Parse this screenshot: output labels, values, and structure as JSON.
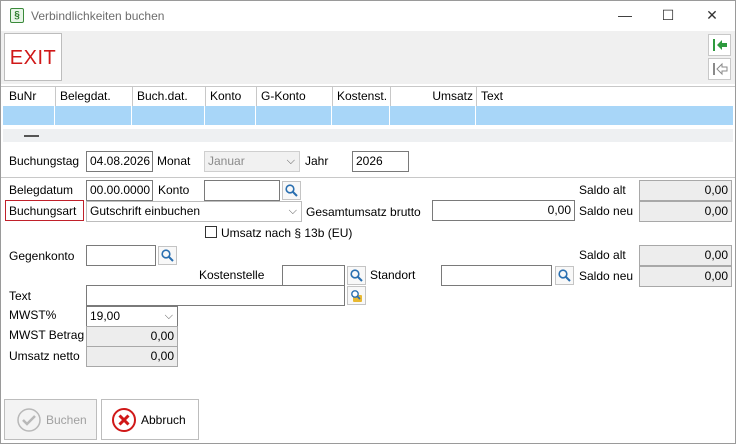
{
  "window": {
    "title": "Verbindlichkeiten buchen",
    "app_icon_glyph": "§",
    "minimize": "—",
    "maximize": "☐",
    "close": "✕"
  },
  "toolbar": {
    "exit_label": "EXIT"
  },
  "grid": {
    "columns": [
      "BuNr",
      "Belegdat.",
      "Buch.dat.",
      "Konto",
      "G-Konto",
      "Kostenst.",
      "Umsatz",
      "Text"
    ],
    "selected_row_color": "#a8d6f8"
  },
  "form": {
    "buchungstag": {
      "label": "Buchungstag",
      "value": "04.08.2026"
    },
    "monat": {
      "label": "Monat",
      "value": "Januar"
    },
    "jahr": {
      "label": "Jahr",
      "value": "2026"
    },
    "belegdatum": {
      "label": "Belegdatum",
      "value": "00.00.0000"
    },
    "konto": {
      "label": "Konto",
      "value": ""
    },
    "buchungsart": {
      "label": "Buchungsart",
      "value": "Gutschrift einbuchen"
    },
    "gesamtumsatz": {
      "label": "Gesamtumsatz brutto",
      "value": "0,00"
    },
    "umsatz13b": {
      "label": "Umsatz nach § 13b (EU)",
      "checked": false
    },
    "saldo_alt_1": {
      "label": "Saldo alt",
      "value": "0,00"
    },
    "saldo_neu_1": {
      "label": "Saldo neu",
      "value": "0,00"
    },
    "gegenkonto": {
      "label": "Gegenkonto",
      "value": ""
    },
    "kostenstelle": {
      "label": "Kostenstelle",
      "value": ""
    },
    "standort": {
      "label": "Standort",
      "value": ""
    },
    "saldo_alt_2": {
      "label": "Saldo alt",
      "value": "0,00"
    },
    "saldo_neu_2": {
      "label": "Saldo neu",
      "value": "0,00"
    },
    "text": {
      "label": "Text",
      "value": ""
    },
    "mwst": {
      "label": "MWST%",
      "value": "19,00"
    },
    "mwst_betrag": {
      "label": "MWST Betrag",
      "value": "0,00"
    },
    "umsatz_netto": {
      "label": "Umsatz netto",
      "value": "0,00"
    }
  },
  "buttons": {
    "buchen": "Buchen",
    "abbruch": "Abbruch"
  },
  "colors": {
    "accent_red": "#d01818",
    "nav_green": "#2e9a3e"
  }
}
